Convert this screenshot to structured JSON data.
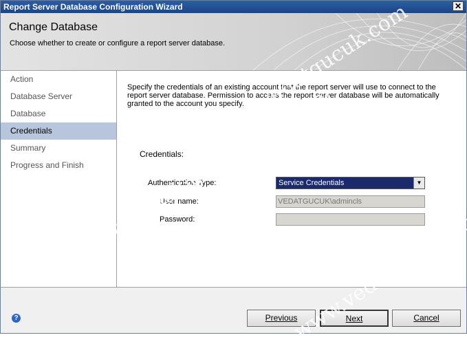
{
  "window": {
    "title": "Report Server Database Configuration Wizard",
    "close_glyph": "✕"
  },
  "header": {
    "title": "Change Database",
    "subtitle": "Choose whether to create or configure a report server database."
  },
  "sidebar": {
    "items": [
      {
        "label": "Action",
        "active": false
      },
      {
        "label": "Database Server",
        "active": false
      },
      {
        "label": "Database",
        "active": false
      },
      {
        "label": "Credentials",
        "active": true
      },
      {
        "label": "Summary",
        "active": false
      },
      {
        "label": "Progress and Finish",
        "active": false
      }
    ]
  },
  "main": {
    "intro": "Specify the credentials of an existing account that the report server will use to connect to the report server database.  Permission to access the report server database will be automatically granted to the account you specify.",
    "credentials_label": "Credentials:",
    "auth_type_label": "Authentication Type:",
    "auth_type_value": "Service Credentials",
    "username_label": "User name:",
    "username_value": "VEDATGUCUK\\admincls",
    "password_label": "Password:",
    "password_value": ""
  },
  "footer": {
    "help_glyph": "?",
    "previous_label": "Previous",
    "next_label": "Next",
    "cancel_label": "Cancel"
  },
  "watermark": {
    "text_a": "www.vedatgucuk.com",
    "text_b": "www.vedatgucuk.com",
    "text_c": "www.vedatgucuk.com",
    "text_d": "www.vedatgucuk.com"
  },
  "colors": {
    "titlebar": "#1c4584",
    "selected_sidebar": "#b7c6dc",
    "select_highlight": "#1a2a6c"
  }
}
